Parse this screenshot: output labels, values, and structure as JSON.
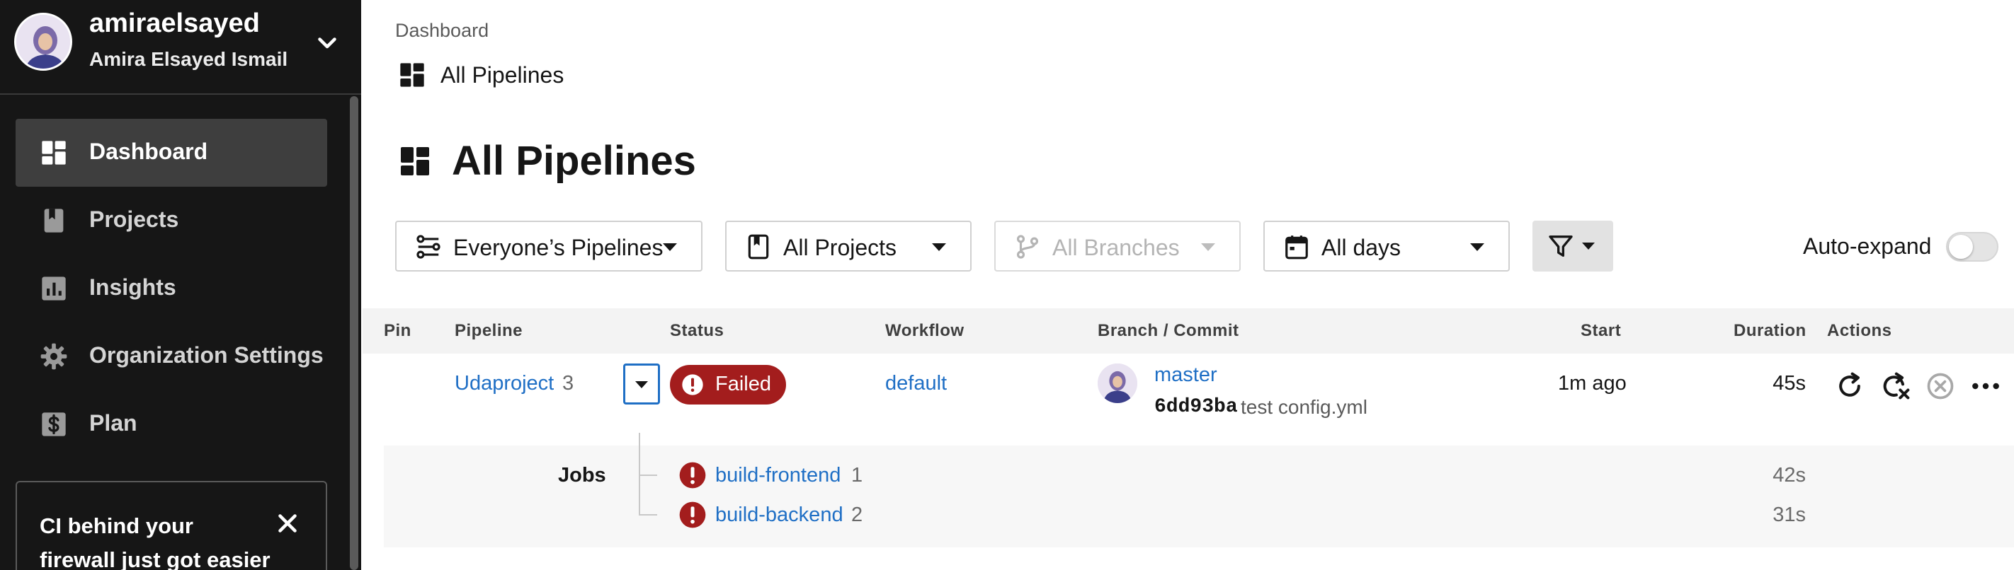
{
  "sidebar": {
    "username": "amiraelsayed",
    "full_name": "Amira Elsayed Ismail",
    "nav": [
      {
        "label": "Dashboard",
        "icon": "dashboard-icon",
        "active": true
      },
      {
        "label": "Projects",
        "icon": "projects-icon",
        "active": false
      },
      {
        "label": "Insights",
        "icon": "insights-icon",
        "active": false
      },
      {
        "label": "Organization Settings",
        "icon": "gear-icon",
        "active": false
      },
      {
        "label": "Plan",
        "icon": "dollar-icon",
        "active": false
      }
    ],
    "promo_text": "CI behind your firewall just got easier"
  },
  "breadcrumb": {
    "root": "Dashboard",
    "current": "All Pipelines"
  },
  "page_title": "All Pipelines",
  "filters": {
    "pipelines": "Everyone’s Pipelines",
    "projects": "All Projects",
    "branches": "All Branches",
    "days": "All days",
    "auto_expand_label": "Auto-expand",
    "auto_expand_on": false
  },
  "table": {
    "headers": [
      "Pin",
      "Pipeline",
      "Status",
      "Workflow",
      "Branch / Commit",
      "Start",
      "Duration",
      "Actions"
    ],
    "row": {
      "pipeline": "Udaproject",
      "number": "3",
      "status": "Failed",
      "workflow": "default",
      "branch": "master",
      "commit_sha": "6dd93ba",
      "commit_message": "test config.yml",
      "start": "1m ago",
      "duration": "45s"
    },
    "jobs_label": "Jobs",
    "jobs": [
      {
        "name": "build-frontend",
        "number": "1",
        "duration": "42s",
        "status": "failed"
      },
      {
        "name": "build-backend",
        "number": "2",
        "duration": "31s",
        "status": "failed"
      }
    ]
  },
  "colors": {
    "sidebar_bg": "#161616",
    "link": "#1f6fc5",
    "failed": "#a31d1d"
  }
}
